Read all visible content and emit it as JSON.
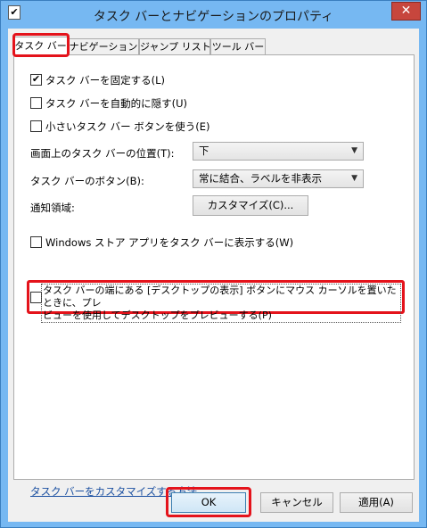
{
  "window": {
    "title": "タスク バーとナビゲーションのプロパティ",
    "close_label": "✕",
    "app_icon_glyph": "✔"
  },
  "tabs": [
    {
      "label": "タスク バー",
      "active": true
    },
    {
      "label": "ナビゲーション",
      "active": false
    },
    {
      "label": "ジャンプ リスト",
      "active": false
    },
    {
      "label": "ツール バー",
      "active": false
    }
  ],
  "options": {
    "lock_taskbar": {
      "label": "タスク バーを固定する(L)",
      "checked": true,
      "check_glyph": "✔"
    },
    "auto_hide": {
      "label": "タスク バーを自動的に隠す(U)",
      "checked": false
    },
    "small_buttons": {
      "label": "小さいタスク バー ボタンを使う(E)",
      "checked": false
    },
    "position": {
      "label": "画面上のタスク バーの位置(T):",
      "value": "下"
    },
    "buttons": {
      "label": "タスク バーのボタン(B):",
      "value": "常に結合、ラベルを非表示"
    },
    "notification": {
      "label": "通知領域:",
      "button": "カスタマイズ(C)..."
    },
    "store_apps": {
      "label": "Windows ストア アプリをタスク バーに表示する(W)",
      "checked": false
    },
    "peek": {
      "line1": "タスク バーの端にある [デスクトップの表示] ボタンにマウス カーソルを置いたときに、プレ",
      "line2": "ビューを使用してデスクトップをプレビューする(P)",
      "checked": false
    }
  },
  "link": {
    "label": "タスク バーをカスタマイズする方法"
  },
  "buttons": {
    "ok": "OK",
    "cancel": "キャンセル",
    "apply": "適用(A)"
  },
  "icons": {
    "dropdown_chevron": "▼"
  },
  "colors": {
    "highlight": "#e4131b",
    "titlebar": "#76b8f2",
    "close": "#c7463d",
    "link": "#1a4fa0"
  }
}
